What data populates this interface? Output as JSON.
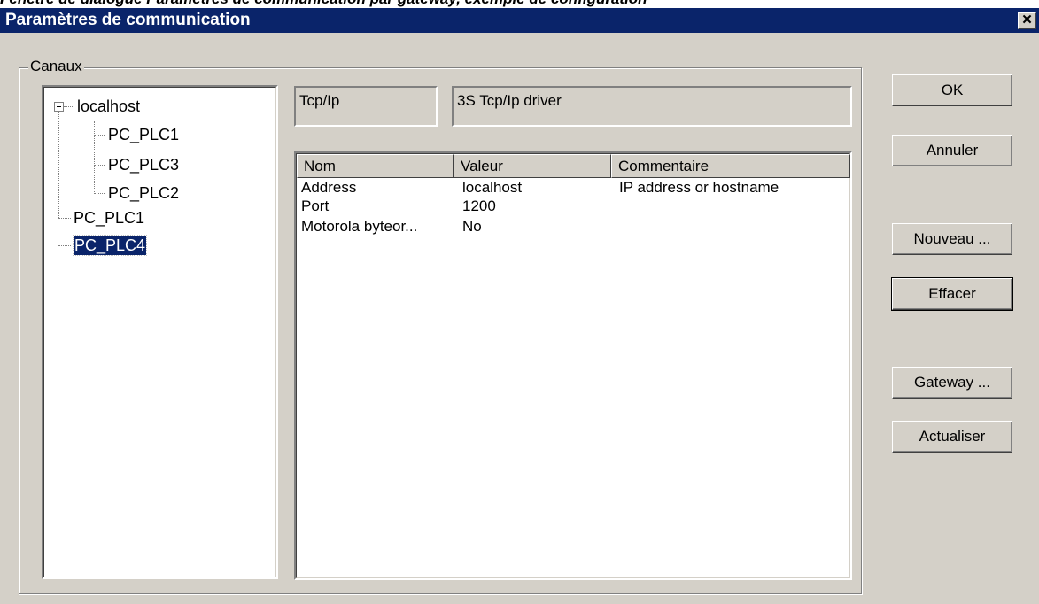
{
  "caption": "Fenêtre de dialogue Paramètres de communication par gateway, exemple de configuration",
  "window": {
    "title": "Paramètres de communication",
    "close_glyph": "✕"
  },
  "channels": {
    "label": "Canaux",
    "tree": [
      {
        "label": "localhost",
        "level": 0,
        "expanded": true,
        "selected": false
      },
      {
        "label": "PC_PLC1",
        "level": 1,
        "selected": false
      },
      {
        "label": "PC_PLC3",
        "level": 1,
        "selected": false
      },
      {
        "label": "PC_PLC2",
        "level": 1,
        "selected": false
      },
      {
        "label": "PC_PLC1",
        "level": 0,
        "selected": false
      },
      {
        "label": "PC_PLC4",
        "level": 0,
        "selected": true
      }
    ]
  },
  "driver": {
    "protocol": "Tcp/Ip",
    "name": "3S Tcp/Ip driver"
  },
  "params": {
    "columns": [
      "Nom",
      "Valeur",
      "Commentaire"
    ],
    "rows": [
      {
        "name": "Address",
        "value": "localhost",
        "comment": "IP address or hostname"
      },
      {
        "name": "Port",
        "value": "1200",
        "comment": ""
      },
      {
        "name": "Motorola byteor...",
        "value": "No",
        "comment": ""
      }
    ]
  },
  "buttons": {
    "ok": "OK",
    "cancel": "Annuler",
    "new": "Nouveau ...",
    "delete": "Effacer",
    "gateway": "Gateway ...",
    "refresh": "Actualiser"
  },
  "colors": {
    "titlebar": "#0a246a",
    "face": "#d4d0c8",
    "selection": "#0a246a"
  }
}
